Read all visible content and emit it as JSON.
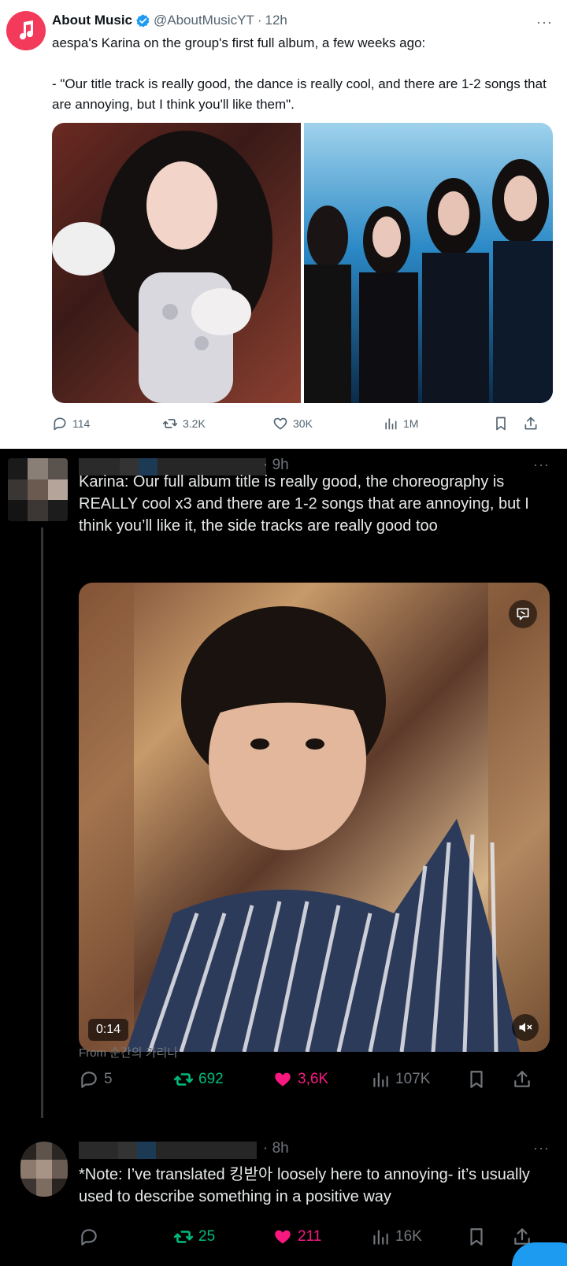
{
  "top_tweet": {
    "name": "About Music",
    "handle": "@AboutMusicYT",
    "dot": "·",
    "time": "12h",
    "more": "···",
    "text": "aespa's Karina on the group's first full album, a few weeks ago:\n\n- \"Our title track is really good, the dance is really cool, and there are 1-2 songs that are annoying, but I think you'll like them\".",
    "actions": {
      "replies": "114",
      "reposts": "3.2K",
      "likes": "30K",
      "views": "1M"
    },
    "colors": {
      "avatar": "#f33a5a",
      "verified": "#1d9bf0"
    }
  },
  "reply1": {
    "time": "· 9h",
    "more": "···",
    "text": "Karina: Our full album title is really good, the choreography is REALLY cool x3 and there are 1-2 songs that are annoying, but I think you’ll like it, the side tracks are really good too",
    "video_duration": "0:14",
    "from": "From 순간의 카리나",
    "actions": {
      "replies": "5",
      "reposts": "692",
      "likes": "3,6K",
      "views": "107K"
    }
  },
  "reply2": {
    "time": "· 8h",
    "more": "···",
    "text": "*Note: I’ve translated 킹받아 loosely here to annoying- it’s usually used to describe something in a positive way",
    "actions": {
      "reposts": "25",
      "likes": "211",
      "views": "16K"
    }
  },
  "colors": {
    "repost_active": "#00ba7c",
    "like_active": "#f91880",
    "muted": "#71767b"
  }
}
